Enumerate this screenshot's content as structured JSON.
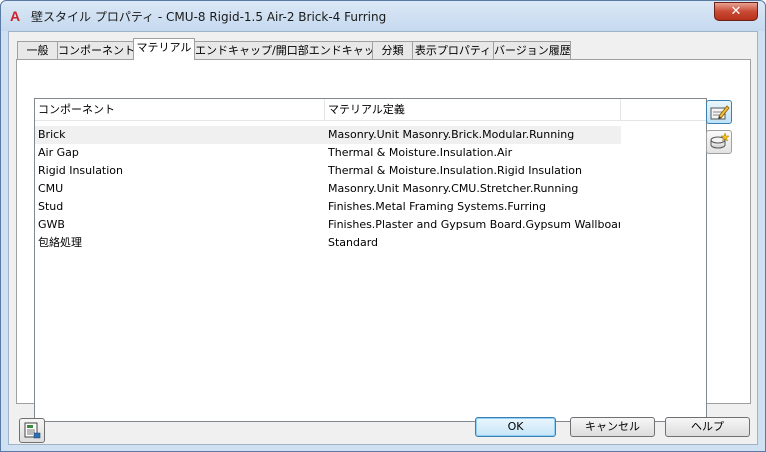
{
  "window": {
    "app_icon_glyph": "A",
    "title": "壁スタイル プロパティ - CMU-8 Rigid-1.5 Air-2 Brick-4 Furring",
    "close_glyph": "✕"
  },
  "tabs": [
    {
      "label": "一般",
      "active": false
    },
    {
      "label": "コンポーネント",
      "active": false
    },
    {
      "label": "マテリアル",
      "active": true
    },
    {
      "label": "エンドキャップ/開口部エンドキャップ",
      "active": false
    },
    {
      "label": "分類",
      "active": false
    },
    {
      "label": "表示プロパティ",
      "active": false
    },
    {
      "label": "バージョン履歴",
      "active": false
    }
  ],
  "materials": {
    "columns": [
      "コンポーネント",
      "マテリアル定義"
    ],
    "rows": [
      [
        "Brick",
        "Masonry.Unit Masonry.Brick.Modular.Running"
      ],
      [
        "Air Gap",
        "Thermal & Moisture.Insulation.Air"
      ],
      [
        "Rigid Insulation",
        "Thermal & Moisture.Insulation.Rigid Insulation"
      ],
      [
        "CMU",
        "Masonry.Unit Masonry.CMU.Stretcher.Running"
      ],
      [
        "Stud",
        "Finishes.Metal Framing Systems.Furring"
      ],
      [
        "GWB",
        "Finishes.Plaster and Gypsum Board.Gypsum Wallboard...."
      ],
      [
        "包絡処理",
        "Standard"
      ]
    ],
    "selected_row": 0
  },
  "side_buttons": {
    "edit_icon": "edit-material-icon",
    "new_icon": "new-material-icon"
  },
  "footer": {
    "ok_label": "OK",
    "cancel_label": "キャンセル",
    "help_label": "ヘルプ",
    "style_icon": "style-browser-icon"
  }
}
